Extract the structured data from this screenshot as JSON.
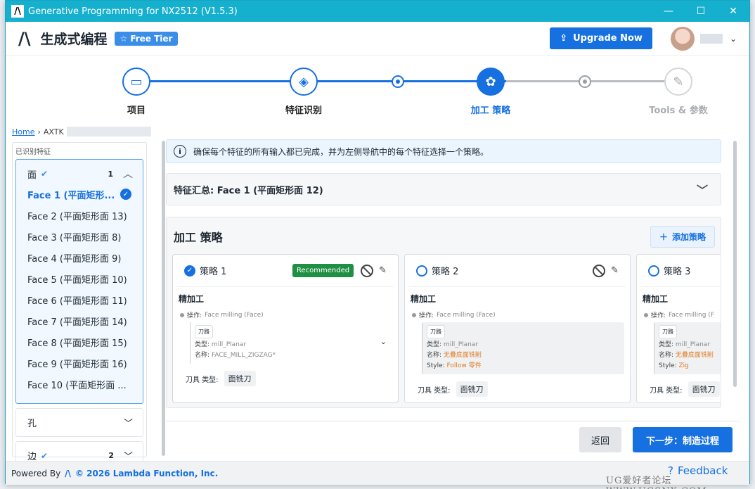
{
  "window": {
    "title": "Generative Programming for NX2512 (V1.5.3)",
    "minimize": "—",
    "maximize": "☐",
    "close": "✕",
    "logo": "/\\"
  },
  "header": {
    "brand": "生成式编程",
    "tier": "Free Tier",
    "upgrade": "Upgrade Now"
  },
  "steps": [
    {
      "label": "项目",
      "state": "done"
    },
    {
      "label": "特征识别",
      "state": "done"
    },
    {
      "label": "加工 策略",
      "state": "active"
    },
    {
      "label": "Tools & 参数",
      "state": "pending"
    }
  ],
  "breadcrumb": {
    "home": "Home",
    "sep": "›",
    "current": "AXTK"
  },
  "sidebar": {
    "title": "已识别特征",
    "groups": [
      {
        "name": "面",
        "count": "1",
        "expanded": true,
        "checked": true,
        "items": [
          "Face 1 (平面矩形...",
          "Face 2 (平面矩形面 13)",
          "Face 3 (平面矩形面 8)",
          "Face 4 (平面矩形面 9)",
          "Face 5 (平面矩形面 10)",
          "Face 6 (平面矩形面 11)",
          "Face 7 (平面矩形面 14)",
          "Face 8 (平面矩形面 15)",
          "Face 9 (平面矩形面 16)",
          "Face 10 (平面矩形面 ..."
        ]
      },
      {
        "name": "孔",
        "count": "",
        "expanded": false,
        "checked": false
      },
      {
        "name": "边",
        "count": "2",
        "expanded": false,
        "checked": true
      }
    ]
  },
  "info": "确保每个特征的所有输入都已完成，并为左侧导航中的每个特征选择一个策略。",
  "summary": "特征汇总: Face 1 (平面矩形面 12)",
  "strategy": {
    "title": "加工 策略",
    "add": "添加策略",
    "cards": [
      {
        "name": "策略 1",
        "badge": "Recommended",
        "selected": true,
        "op_title": "精加工",
        "op_label": "操作:",
        "op_value": "Face milling (Face)",
        "tag": "刀路",
        "type_k": "类型:",
        "type_v": "mill_Planar",
        "name_k": "名称:",
        "name_v": "FACE_MILL_ZIGZAG*",
        "style_k": "",
        "style_v": "",
        "tool_k": "刀具 类型:",
        "tool_v": "面铣刀"
      },
      {
        "name": "策略 2",
        "badge": "",
        "selected": false,
        "op_title": "精加工",
        "op_label": "操作:",
        "op_value": "Face milling (Face)",
        "tag": "刀路",
        "type_k": "类型:",
        "type_v": "mill_Planar",
        "name_k": "名称:",
        "name_v": "无疊底面铣削",
        "style_k": "Style:",
        "style_v": "Follow 零件",
        "tool_k": "刀具 类型:",
        "tool_v": "面铣刀"
      },
      {
        "name": "策略 3",
        "badge": "",
        "selected": false,
        "op_title": "精加工",
        "op_label": "操作:",
        "op_value": "Face milling (F",
        "tag": "刀路",
        "type_k": "类型:",
        "type_v": "mill_Planar",
        "name_k": "名称:",
        "name_v": "无疊底面铣削",
        "style_k": "Style:",
        "style_v": "Zig",
        "tool_k": "刀具 类型:",
        "tool_v": "面铣刀"
      }
    ]
  },
  "footer": {
    "back": "返回",
    "next": "下一步：制造过程"
  },
  "statusbar": {
    "powered": "Powered By",
    "copyright": "© 2026 Lambda Function, Inc.",
    "feedback": "Feedback"
  },
  "watermark": "UG爱好者论坛 WWW.UGSNX.COM",
  "colors": {
    "accent": "#1670e0",
    "titlebar": "#16b0cf",
    "recommended": "#1f8f43",
    "orange": "#e07a1f"
  }
}
